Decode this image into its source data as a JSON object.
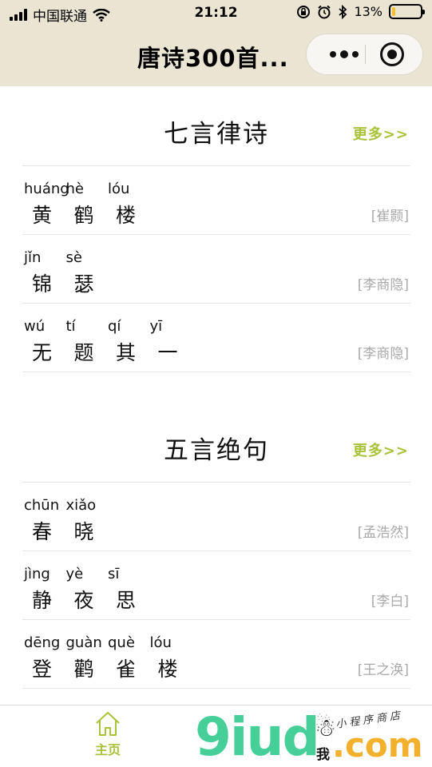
{
  "status_bar": {
    "carrier": "中国联通",
    "time": "21:12",
    "battery_text": "13%",
    "battery_level": 0.13
  },
  "nav": {
    "title": "唐诗300首..."
  },
  "sections": [
    {
      "title": "七言律诗",
      "more": "更多>>",
      "poems": [
        {
          "chars": [
            {
              "py": "huáng",
              "hz": "黄"
            },
            {
              "py": "hè",
              "hz": "鹤"
            },
            {
              "py": "lóu",
              "hz": "楼"
            }
          ],
          "author": "[崔颢]"
        },
        {
          "chars": [
            {
              "py": "jǐn",
              "hz": "锦"
            },
            {
              "py": "sè",
              "hz": "瑟"
            }
          ],
          "author": "[李商隐]"
        },
        {
          "chars": [
            {
              "py": "wú",
              "hz": "无"
            },
            {
              "py": "tí",
              "hz": "题"
            },
            {
              "py": "qí",
              "hz": "其"
            },
            {
              "py": "yī",
              "hz": "一"
            }
          ],
          "author": "[李商隐]"
        }
      ]
    },
    {
      "title": "五言绝句",
      "more": "更多>>",
      "poems": [
        {
          "chars": [
            {
              "py": "chūn",
              "hz": "春"
            },
            {
              "py": "xiǎo",
              "hz": "晓"
            }
          ],
          "author": "[孟浩然]"
        },
        {
          "chars": [
            {
              "py": "jìng",
              "hz": "静"
            },
            {
              "py": "yè",
              "hz": "夜"
            },
            {
              "py": "sī",
              "hz": "思"
            }
          ],
          "author": "[李白]"
        },
        {
          "chars": [
            {
              "py": "dēng",
              "hz": "登"
            },
            {
              "py": "guàn",
              "hz": "鹳"
            },
            {
              "py": "què",
              "hz": "雀"
            },
            {
              "py": "lóu",
              "hz": "楼"
            }
          ],
          "author": "[王之涣]"
        }
      ]
    }
  ],
  "tabbar": {
    "home_label": "主页"
  },
  "watermark": {
    "brand": "9iud",
    "wo": "我",
    "com": ".com",
    "tagline": "小程序商店"
  },
  "colors": {
    "nav_bg": "#e9e5d2",
    "accent": "#a8c23a",
    "author_gray": "#a9a9a9"
  }
}
